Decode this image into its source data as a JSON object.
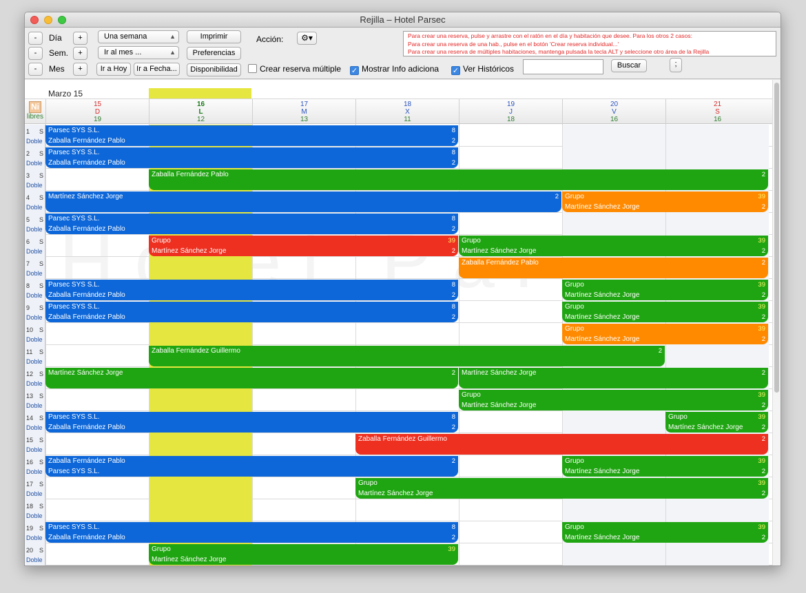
{
  "window": {
    "title": "Rejilla – Hotel Parsec"
  },
  "toolbar": {
    "minus": "-",
    "plus": "+",
    "dia": "Día",
    "sem": "Sem.",
    "mes": "Mes",
    "select_range": "Una semana",
    "select_month": "Ir al mes ...",
    "ir_hoy": "Ir a Hoy",
    "ir_fecha": "Ir a Fecha...",
    "imprimir": "Imprimir",
    "preferencias": "Preferencias",
    "disponibilidad": "Disponibilidad",
    "accion": "Acción:",
    "crear_multiple": "Crear reserva múltiple",
    "mostrar_info": "Mostrar Info adiciona",
    "ver_historicos": "Ver Históricos",
    "buscar": "Buscar",
    "semicolon": ";",
    "info_lines": [
      "Para crear una reserva, pulse y arrastre con el ratón en el día y habitación que desee. Para los otros 2 casos:",
      "Para crear una reserva de una hab., pulse en el botón 'Crear reserva individual...'",
      "Para crear una reserva de múltiples habitaciones, mantenga pulsada la tecla ALT y seleccione otro área de la Rejilla"
    ],
    "checks": {
      "crear_multiple": false,
      "mostrar_info": true,
      "ver_historicos": true
    }
  },
  "grid": {
    "month_label": "Marzo 15",
    "corner_ni": "Ni",
    "corner_libres": "libres",
    "watermark": "Hotel Parsec",
    "days": [
      {
        "num": "15",
        "wd": "D",
        "free": "19",
        "color": "#d62b2b"
      },
      {
        "num": "16",
        "wd": "L",
        "free": "12",
        "color": "#1a7a1a"
      },
      {
        "num": "17",
        "wd": "M",
        "free": "13",
        "color": "#2a52be"
      },
      {
        "num": "18",
        "wd": "X",
        "free": "11",
        "color": "#2a52be"
      },
      {
        "num": "19",
        "wd": "J",
        "free": "18",
        "color": "#2a52be"
      },
      {
        "num": "20",
        "wd": "V",
        "free": "16",
        "color": "#2a52be"
      },
      {
        "num": "21",
        "wd": "S",
        "free": "16",
        "color": "#d62b2b"
      }
    ],
    "rooms": [
      {
        "num": "1",
        "type": "S",
        "cat": "Doble"
      },
      {
        "num": "2",
        "type": "S",
        "cat": "Doble"
      },
      {
        "num": "3",
        "type": "S",
        "cat": "Doble"
      },
      {
        "num": "4",
        "type": "S",
        "cat": "Doble"
      },
      {
        "num": "5",
        "type": "S",
        "cat": "Doble"
      },
      {
        "num": "6",
        "type": "S",
        "cat": "Doble"
      },
      {
        "num": "7",
        "type": "S",
        "cat": "Doble"
      },
      {
        "num": "8",
        "type": "S",
        "cat": "Doble"
      },
      {
        "num": "9",
        "type": "S",
        "cat": "Doble"
      },
      {
        "num": "10",
        "type": "S",
        "cat": "Doble"
      },
      {
        "num": "11",
        "type": "S",
        "cat": "Doble"
      },
      {
        "num": "12",
        "type": "S",
        "cat": "Doble"
      },
      {
        "num": "13",
        "type": "S",
        "cat": "Doble"
      },
      {
        "num": "14",
        "type": "S",
        "cat": "Doble"
      },
      {
        "num": "15",
        "type": "S",
        "cat": "Doble"
      },
      {
        "num": "16",
        "type": "S",
        "cat": "Doble"
      },
      {
        "num": "17",
        "type": "S",
        "cat": "Doble"
      },
      {
        "num": "18",
        "type": "S",
        "cat": "Doble"
      },
      {
        "num": "19",
        "type": "S",
        "cat": "Doble"
      },
      {
        "num": "20",
        "type": "S",
        "cat": "Doble"
      }
    ],
    "colors": {
      "blue": "#0e67d8",
      "green": "#1fa511",
      "orange": "#ff8a00",
      "red": "#ee3020"
    },
    "reservations": [
      {
        "room": 0,
        "start": 0,
        "end": 4,
        "color": "blue",
        "l1": "Parsec SYS S.L.",
        "l2": "Zaballa Fernández Pablo",
        "c1": "8",
        "c2": "2"
      },
      {
        "room": 1,
        "start": 0,
        "end": 4,
        "color": "blue",
        "l1": "Parsec SYS S.L.",
        "l2": "Zaballa Fernández Pablo",
        "c1": "8",
        "c2": "2"
      },
      {
        "room": 2,
        "start": 1,
        "end": 7,
        "color": "green",
        "l1": "Zaballa Fernández Pablo",
        "l2": "",
        "c1": "2",
        "c2": ""
      },
      {
        "room": 3,
        "start": 0,
        "end": 5,
        "color": "blue",
        "l1": "Martínez Sánchez Jorge",
        "l2": "",
        "c1": "2",
        "c2": ""
      },
      {
        "room": 3,
        "start": 5,
        "end": 7,
        "color": "orange",
        "l1": "Grupo",
        "l2": "Martínez Sánchez Jorge",
        "c1": "39",
        "c2": "2"
      },
      {
        "room": 4,
        "start": 0,
        "end": 4,
        "color": "blue",
        "l1": "Parsec SYS S.L.",
        "l2": "Zaballa Fernández Pablo",
        "c1": "8",
        "c2": "2"
      },
      {
        "room": 5,
        "start": 1,
        "end": 4,
        "color": "red",
        "l1": "Grupo",
        "l2": "Martínez Sánchez Jorge",
        "c1": "39",
        "c2": "2"
      },
      {
        "room": 5,
        "start": 4,
        "end": 7,
        "color": "green",
        "l1": "Grupo",
        "l2": "Martínez Sánchez Jorge",
        "c1": "39",
        "c2": "2"
      },
      {
        "room": 6,
        "start": 4,
        "end": 7,
        "color": "orange",
        "l1": "Zaballa Fernández Pablo",
        "l2": "",
        "c1": "2",
        "c2": ""
      },
      {
        "room": 7,
        "start": 0,
        "end": 4,
        "color": "blue",
        "l1": "Parsec SYS S.L.",
        "l2": "Zaballa Fernández Pablo",
        "c1": "8",
        "c2": "2"
      },
      {
        "room": 7,
        "start": 5,
        "end": 7,
        "color": "green",
        "l1": "Grupo",
        "l2": "Martínez Sánchez Jorge",
        "c1": "39",
        "c2": "2"
      },
      {
        "room": 8,
        "start": 0,
        "end": 4,
        "color": "blue",
        "l1": "Parsec SYS S.L.",
        "l2": "Zaballa Fernández Pablo",
        "c1": "8",
        "c2": "2"
      },
      {
        "room": 8,
        "start": 5,
        "end": 7,
        "color": "green",
        "l1": "Grupo",
        "l2": "Martínez Sánchez Jorge",
        "c1": "39",
        "c2": "2"
      },
      {
        "room": 9,
        "start": 5,
        "end": 7,
        "color": "orange",
        "l1": "Grupo",
        "l2": "Martínez Sánchez Jorge",
        "c1": "39",
        "c2": "2"
      },
      {
        "room": 10,
        "start": 1,
        "end": 6,
        "color": "green",
        "l1": "Zaballa Fernández Guillermo",
        "l2": "",
        "c1": "2",
        "c2": ""
      },
      {
        "room": 11,
        "start": 0,
        "end": 4,
        "color": "green",
        "l1": "Martínez Sánchez Jorge",
        "l2": "",
        "c1": "2",
        "c2": ""
      },
      {
        "room": 11,
        "start": 4,
        "end": 7,
        "color": "green",
        "l1": "Martínez Sánchez Jorge",
        "l2": "",
        "c1": "2",
        "c2": ""
      },
      {
        "room": 12,
        "start": 4,
        "end": 7,
        "color": "green",
        "l1": "Grupo",
        "l2": "Martínez Sánchez Jorge",
        "c1": "39",
        "c2": "2"
      },
      {
        "room": 13,
        "start": 0,
        "end": 4,
        "color": "blue",
        "l1": "Parsec SYS S.L.",
        "l2": "Zaballa Fernández Pablo",
        "c1": "8",
        "c2": "2"
      },
      {
        "room": 13,
        "start": 6,
        "end": 7,
        "color": "green",
        "l1": "Grupo",
        "l2": "Martínez Sánchez Jorge",
        "c1": "39",
        "c2": "2"
      },
      {
        "room": 14,
        "start": 3,
        "end": 7,
        "color": "red",
        "l1": "Zaballa Fernández Guillermo",
        "l2": "",
        "c1": "2",
        "c2": ""
      },
      {
        "room": 15,
        "start": 0,
        "end": 4,
        "color": "blue",
        "l1": "Zaballa Fernández Pablo",
        "l2": "Parsec SYS S.L.",
        "c1": "2",
        "c2": ""
      },
      {
        "room": 15,
        "start": 5,
        "end": 7,
        "color": "green",
        "l1": "Grupo",
        "l2": "Martínez Sánchez Jorge",
        "c1": "39",
        "c2": "2"
      },
      {
        "room": 16,
        "start": 3,
        "end": 7,
        "color": "green",
        "l1": "Grupo",
        "l2": "Martínez Sánchez Jorge",
        "c1": "39",
        "c2": "2"
      },
      {
        "room": 18,
        "start": 0,
        "end": 4,
        "color": "blue",
        "l1": "Parsec SYS S.L.",
        "l2": "Zaballa Fernández Pablo",
        "c1": "8",
        "c2": "2"
      },
      {
        "room": 18,
        "start": 5,
        "end": 7,
        "color": "green",
        "l1": "Grupo",
        "l2": "Martínez Sánchez Jorge",
        "c1": "39",
        "c2": "2"
      },
      {
        "room": 19,
        "start": 1,
        "end": 4,
        "color": "green",
        "l1": "Grupo",
        "l2": "Martínez Sánchez Jorge",
        "c1": "39",
        "c2": ""
      }
    ]
  }
}
